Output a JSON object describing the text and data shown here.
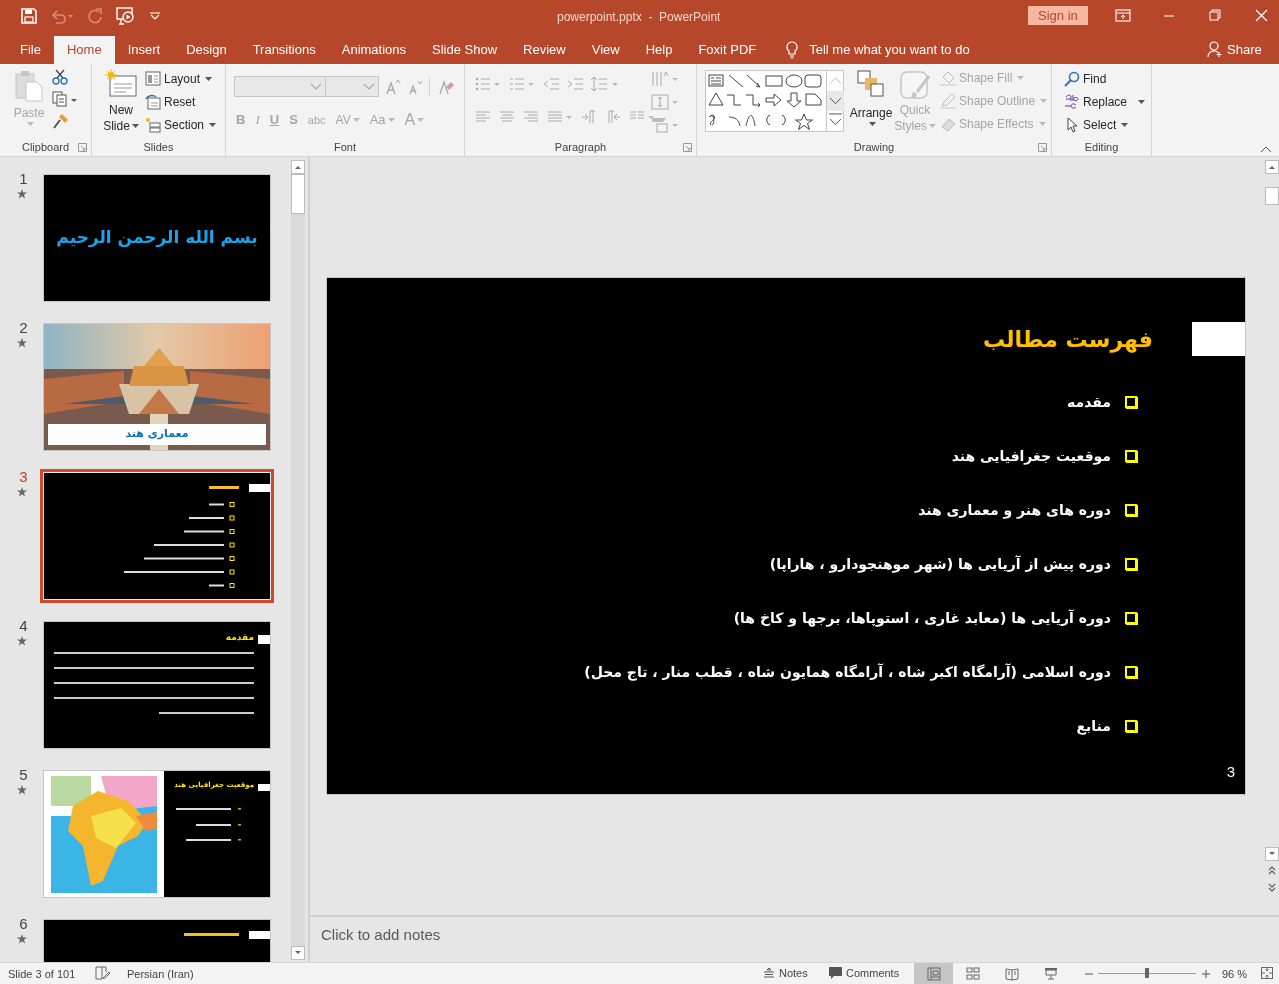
{
  "window": {
    "title": "powerpoint.pptx  -  PowerPoint",
    "sign_in": "Sign in"
  },
  "tabs": [
    {
      "label": "File",
      "selected": false
    },
    {
      "label": "Home",
      "selected": true
    },
    {
      "label": "Insert",
      "selected": false
    },
    {
      "label": "Design",
      "selected": false
    },
    {
      "label": "Transitions",
      "selected": false
    },
    {
      "label": "Animations",
      "selected": false
    },
    {
      "label": "Slide Show",
      "selected": false
    },
    {
      "label": "Review",
      "selected": false
    },
    {
      "label": "View",
      "selected": false
    },
    {
      "label": "Help",
      "selected": false
    },
    {
      "label": "Foxit PDF",
      "selected": false
    }
  ],
  "tell_me": "Tell me what you want to do",
  "share": "Share",
  "ribbon": {
    "clipboard": {
      "label": "Clipboard",
      "paste": {
        "label": "Paste",
        "disabled": true
      }
    },
    "slides": {
      "label": "Slides",
      "new_slide": [
        "New",
        "Slide"
      ],
      "layout": "Layout",
      "reset": "Reset",
      "section": "Section"
    },
    "font": {
      "label": "Font",
      "buttons": [
        "B",
        "I",
        "U",
        "S",
        "abc",
        "AV",
        "Aa",
        "A"
      ]
    },
    "paragraph": {
      "label": "Paragraph"
    },
    "drawing": {
      "label": "Drawing",
      "arrange": "Arrange",
      "quick_styles": {
        "lines": [
          "Quick",
          "Styles"
        ],
        "disabled": true
      },
      "shape_buttons": [
        {
          "label": "Shape Fill",
          "disabled": true
        },
        {
          "label": "Shape Outline",
          "disabled": true
        },
        {
          "label": "Shape Effects",
          "disabled": true
        }
      ]
    },
    "editing": {
      "label": "Editing",
      "find": "Find",
      "replace": "Replace",
      "select": "Select"
    }
  },
  "thumbnails": [
    {
      "number": "1",
      "selected": false,
      "kind": "title",
      "title": "بسم الله الرحمن الرحیم"
    },
    {
      "number": "2",
      "selected": false,
      "title": "معماری هند"
    },
    {
      "number": "3",
      "selected": true,
      "kind": "list"
    },
    {
      "number": "4",
      "selected": false,
      "kind": "text",
      "title": "مقدمه"
    },
    {
      "number": "5",
      "selected": false,
      "kind": "map",
      "title": "موقعیت جغرافیایی هند"
    },
    {
      "number": "6",
      "selected": false,
      "kind": "list"
    }
  ],
  "slide": {
    "title": "فهرست مطالب",
    "items": [
      "مقدمه",
      "موقعیت جغرافیایی هند",
      "دوره های هنر و معماری هند",
      "دوره پیش از آریایی ها (شهر موهنجودارو ، هاراپا)",
      "دوره آریایی ها (معابد غاری ، استوپاها، برجها و کاخ ها)",
      "دوره اسلامی (آرامگاه اکبر شاه ، آرامگاه همایون شاه ، قطب منار ، تاج محل)",
      "منابع"
    ],
    "page_number": "3"
  },
  "notes": {
    "placeholder": "Click to add notes"
  },
  "status_bar": {
    "slide_info": "Slide 3 of 101",
    "language": "Persian (Iran)",
    "notes": "Notes",
    "comments": "Comments",
    "views": [
      {
        "kind": "normal",
        "selected": true
      },
      {
        "kind": "sorter",
        "selected": false
      },
      {
        "kind": "reading",
        "selected": false
      },
      {
        "kind": "slideshow",
        "selected": false
      }
    ],
    "zoom": {
      "level": 0.5,
      "reading": "96 %"
    }
  }
}
